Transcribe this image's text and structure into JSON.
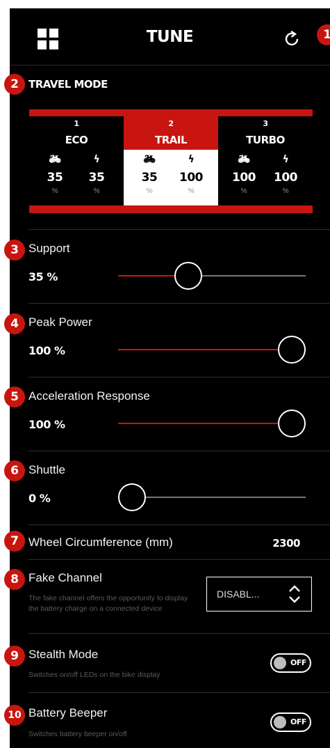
{
  "header": {
    "title": "TUNE",
    "badge": "1",
    "left_icon": "grid-icon",
    "right_icon": "refresh-icon"
  },
  "travel_mode": {
    "badge": "2",
    "title": "TRAVEL MODE",
    "modes": [
      {
        "num": "1",
        "name": "ECO",
        "support": "35",
        "peak": "35",
        "unit": "%",
        "selected": false
      },
      {
        "num": "2",
        "name": "TRAIL",
        "support": "35",
        "peak": "100",
        "unit": "%",
        "selected": true
      },
      {
        "num": "3",
        "name": "TURBO",
        "support": "100",
        "peak": "100",
        "unit": "%",
        "selected": false
      }
    ]
  },
  "support": {
    "badge": "3",
    "label": "Support",
    "value": "35 %",
    "fraction": 0.35
  },
  "peak_power": {
    "badge": "4",
    "label": "Peak Power",
    "value": "100 %",
    "fraction": 1.0
  },
  "acceleration": {
    "badge": "5",
    "label": "Acceleration Response",
    "value": "100 %",
    "fraction": 1.0
  },
  "shuttle": {
    "badge": "6",
    "label": "Shuttle",
    "value": "0 %",
    "fraction": 0.0
  },
  "wheel": {
    "badge": "7",
    "label": "Wheel Circumference (mm)",
    "value": "2300"
  },
  "fake_channel": {
    "badge": "8",
    "label": "Fake Channel",
    "description": "The fake channel offers the opportunity to display the battery charge on a connected device",
    "select_value": "DISABL..."
  },
  "stealth": {
    "badge": "9",
    "label": "Stealth Mode",
    "description": "Switches on/off LEDs on the bike display",
    "toggle": "OFF"
  },
  "beeper": {
    "badge": "10",
    "label": "Battery Beeper",
    "description": "Switches battery beeper on/off",
    "toggle": "OFF"
  },
  "colors": {
    "accent": "#c8150f",
    "background": "#000000",
    "track": "#777777"
  }
}
